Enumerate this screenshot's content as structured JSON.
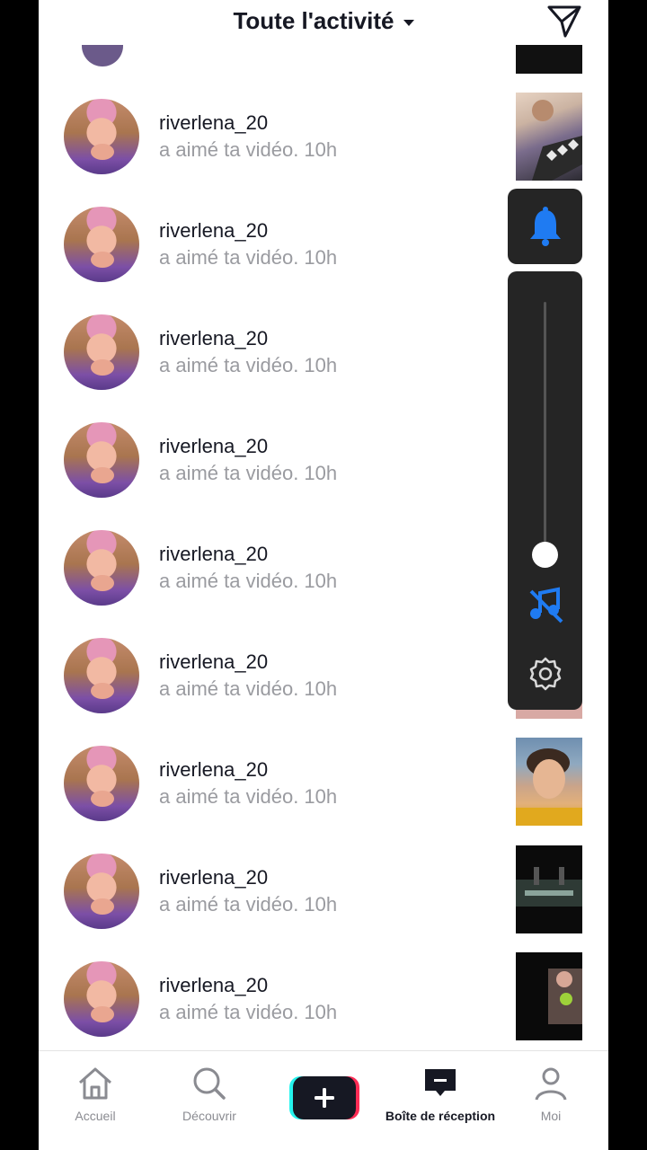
{
  "header": {
    "title": "Toute l'activité"
  },
  "notifications": [
    {
      "username": "riverlena_20",
      "action": "a aimé ta vidéo. 10h",
      "thumb": "boy-on-couch"
    },
    {
      "username": "riverlena_20",
      "action": "a aimé ta vidéo. 10h",
      "thumb": "dark"
    },
    {
      "username": "riverlena_20",
      "action": "a aimé ta vidéo. 10h",
      "thumb": "dark"
    },
    {
      "username": "riverlena_20",
      "action": "a aimé ta vidéo. 10h",
      "thumb": "dark"
    },
    {
      "username": "riverlena_20",
      "action": "a aimé ta vidéo. 10h",
      "thumb": "dark"
    },
    {
      "username": "riverlena_20",
      "action": "a aimé ta vidéo. 10h",
      "thumb": "pink"
    },
    {
      "username": "riverlena_20",
      "action": "a aimé ta vidéo. 10h",
      "thumb": "boy-face"
    },
    {
      "username": "riverlena_20",
      "action": "a aimé ta vidéo. 10h",
      "thumb": "night-scene"
    },
    {
      "username": "riverlena_20",
      "action": "a aimé ta vidéo. 10h",
      "thumb": "girl-dark"
    }
  ],
  "nav": {
    "home": "Accueil",
    "discover": "Découvrir",
    "inbox": "Boîte de réception",
    "profile": "Moi"
  },
  "colors": {
    "accent_blue": "#1f7bf2",
    "panel_bg": "#252525",
    "tiktok_cyan": "#25f4ee",
    "tiktok_red": "#fe2c55"
  },
  "panel": {
    "volume_level": 0.0
  }
}
